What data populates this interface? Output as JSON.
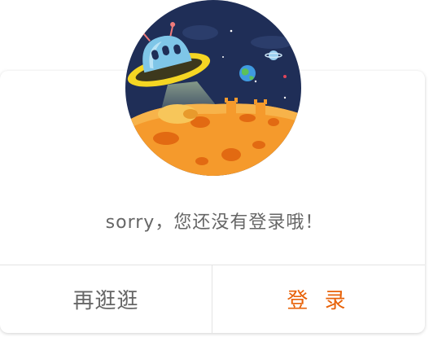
{
  "dialog": {
    "message": "sorry，您还没有登录哦！",
    "browse_button": "再逛逛",
    "login_button": "登 录"
  },
  "illustration": {
    "icon": "ufo-planet-illustration",
    "colors": {
      "space": "#1f2e57",
      "planet": "#f59a2c",
      "ufo_rim": "#f5d623",
      "ufo_dome": "#7fc6e8",
      "accent": "#e8630a"
    }
  }
}
